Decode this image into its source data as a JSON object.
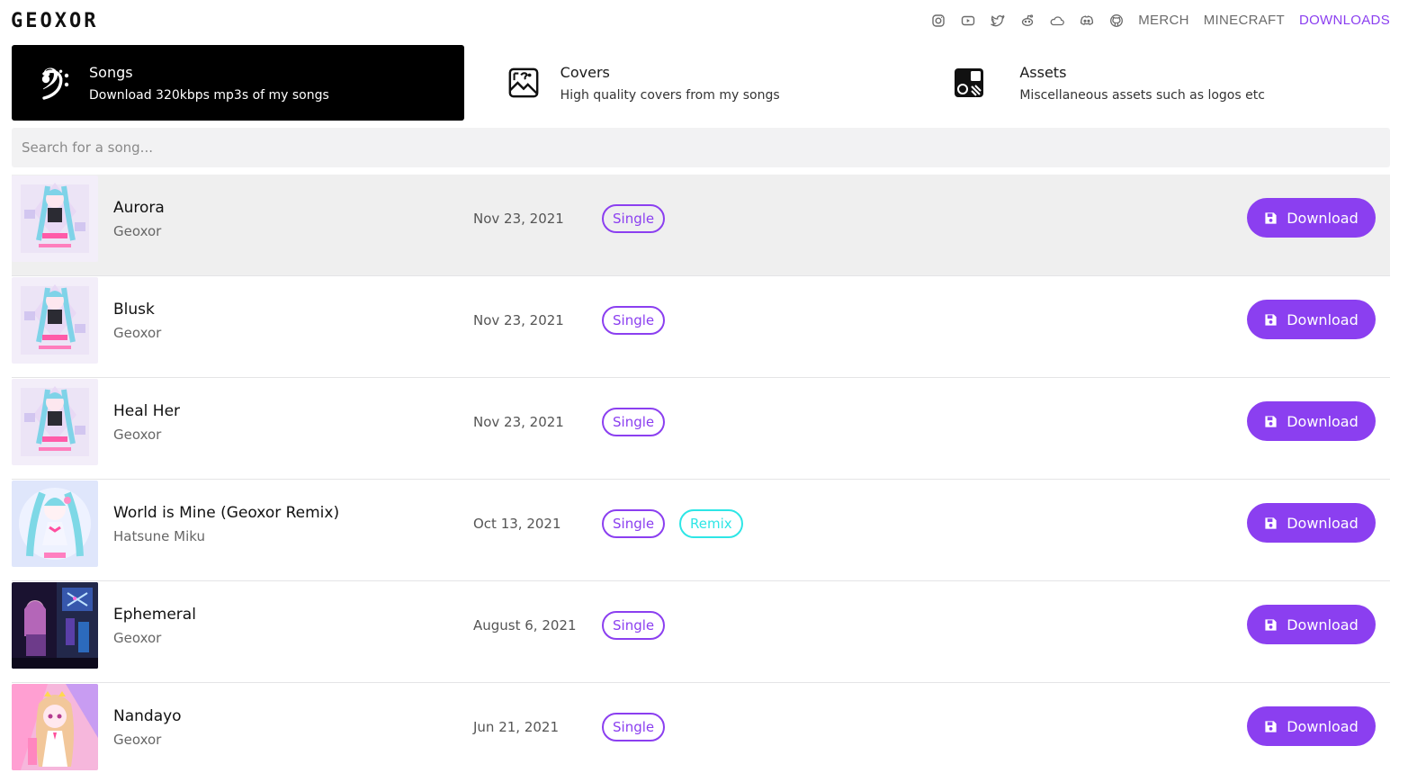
{
  "brand": {
    "logo_text": "GEOXOR",
    "accent": "#8b3ff0",
    "remix_color": "#2ee6e6"
  },
  "nav": {
    "icons": [
      "instagram-icon",
      "youtube-icon",
      "twitter-icon",
      "reddit-icon",
      "soundcloud-icon",
      "discord-icon",
      "github-icon"
    ],
    "links": [
      {
        "label": "MERCH"
      },
      {
        "label": "MINECRAFT"
      },
      {
        "label": "DOWNLOADS",
        "active": true
      }
    ]
  },
  "categories": [
    {
      "title": "Songs",
      "subtitle": "Download 320kbps mp3s of my songs",
      "icon": "bass-clef-icon",
      "active": true
    },
    {
      "title": "Covers",
      "subtitle": "High quality covers from my songs",
      "icon": "image-icon"
    },
    {
      "title": "Assets",
      "subtitle": "Miscellaneous assets such as logos etc",
      "icon": "assets-icon"
    }
  ],
  "search": {
    "placeholder": "Search for a song...",
    "value": ""
  },
  "songs": [
    {
      "title": "Aurora",
      "artist": "Geoxor",
      "date": "Nov 23, 2021",
      "tags": [
        "Single"
      ],
      "cover": "cover-pink-vocaloid",
      "hover": true
    },
    {
      "title": "Blusk",
      "artist": "Geoxor",
      "date": "Nov 23, 2021",
      "tags": [
        "Single"
      ],
      "cover": "cover-pink-vocaloid"
    },
    {
      "title": "Heal Her",
      "artist": "Geoxor",
      "date": "Nov 23, 2021",
      "tags": [
        "Single"
      ],
      "cover": "cover-pink-vocaloid"
    },
    {
      "title": "World is Mine (Geoxor Remix)",
      "artist": "Hatsune Miku",
      "date": "Oct 13, 2021",
      "tags": [
        "Single",
        "Remix"
      ],
      "cover": "cover-miku"
    },
    {
      "title": "Ephemeral",
      "artist": "Geoxor",
      "date": "August 6, 2021",
      "tags": [
        "Single"
      ],
      "cover": "cover-city-night"
    },
    {
      "title": "Nandayo",
      "artist": "Geoxor",
      "date": "Jun 21, 2021",
      "tags": [
        "Single"
      ],
      "cover": "cover-nandayo"
    }
  ],
  "download_label": "Download"
}
